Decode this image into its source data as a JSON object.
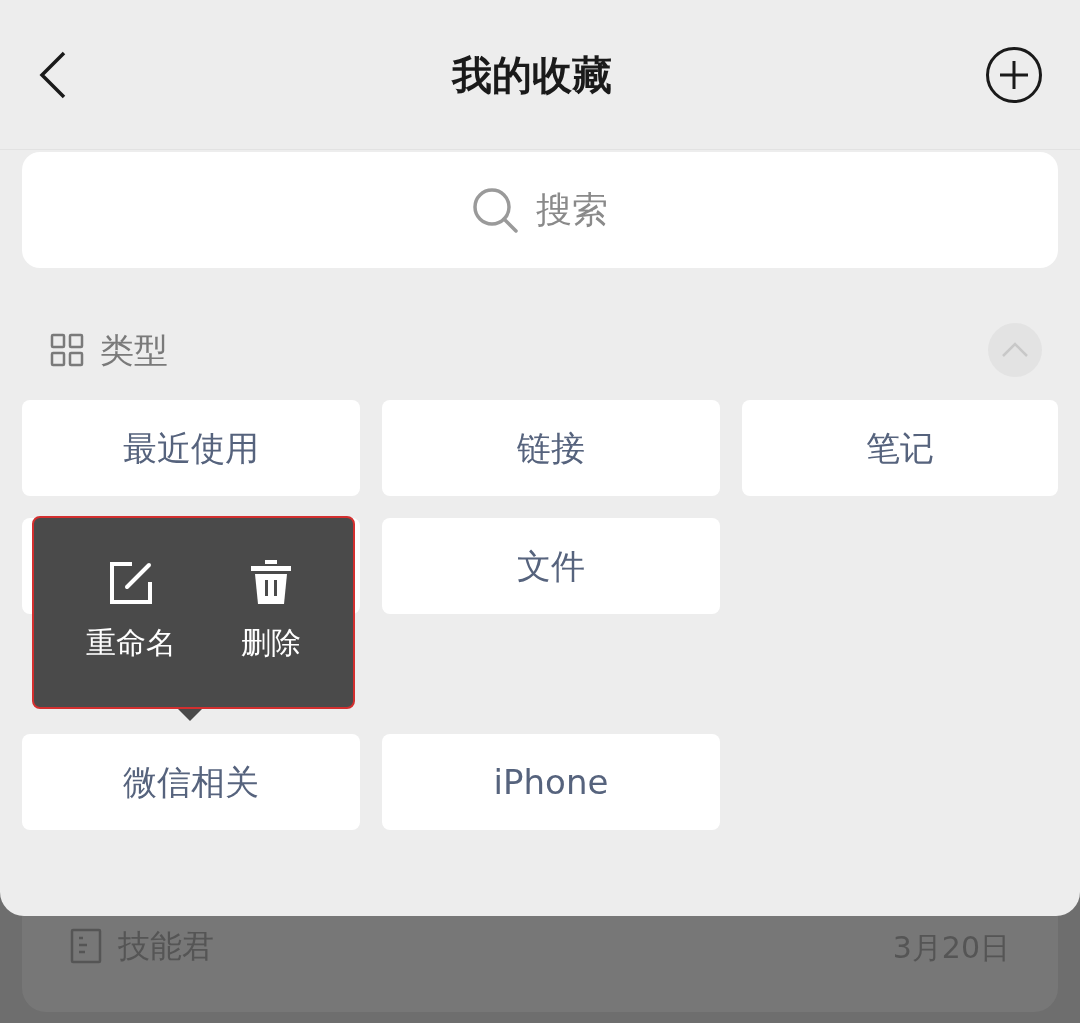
{
  "header": {
    "title": "我的收藏"
  },
  "search": {
    "placeholder": "搜索"
  },
  "section": {
    "title": "类型",
    "expanded": true
  },
  "types": [
    {
      "kind": "tile",
      "label": "最近使用"
    },
    {
      "kind": "tile",
      "label": "链接"
    },
    {
      "kind": "tile",
      "label": "笔记"
    },
    {
      "kind": "covered"
    },
    {
      "kind": "tile",
      "label": "文件"
    }
  ],
  "context_menu": {
    "items": [
      {
        "kind": "rename",
        "label": "重命名"
      },
      {
        "kind": "delete",
        "label": "删除"
      }
    ]
  },
  "tags": [
    {
      "label": "微信相关"
    },
    {
      "label": "iPhone"
    }
  ],
  "background_item": {
    "title": "技能君",
    "date": "3月20日"
  }
}
